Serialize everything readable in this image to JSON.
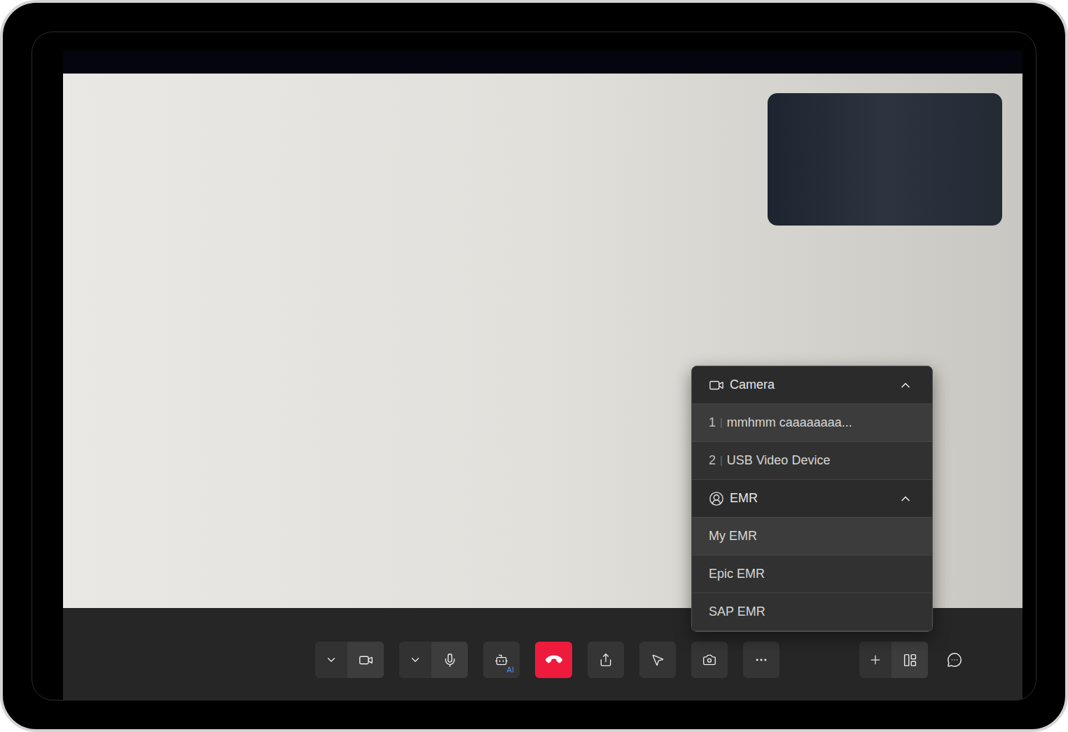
{
  "device_menu": {
    "index_separator": "|",
    "sections": [
      {
        "name": "Camera",
        "kind": "camera",
        "expanded": true,
        "items": [
          {
            "index": "1",
            "label": "mmhmm caaaaaaaa...",
            "selected": true
          },
          {
            "index": "2",
            "label": "USB Video Device",
            "selected": false
          }
        ]
      },
      {
        "name": "EMR",
        "kind": "emr",
        "expanded": true,
        "items": [
          {
            "label": "My EMR",
            "selected": true
          },
          {
            "label": "Epic EMR",
            "selected": false
          },
          {
            "label": "SAP EMR",
            "selected": false
          }
        ]
      }
    ]
  },
  "toolbar": {
    "main": [
      {
        "name": "camera",
        "kind": "split"
      },
      {
        "name": "microphone",
        "kind": "split"
      },
      {
        "name": "ai-assistant",
        "kind": "icon",
        "badge": "AI"
      },
      {
        "name": "hang-up",
        "kind": "danger"
      },
      {
        "name": "share",
        "kind": "icon"
      },
      {
        "name": "pointer",
        "kind": "icon"
      },
      {
        "name": "snapshot",
        "kind": "icon"
      },
      {
        "name": "more",
        "kind": "icon"
      }
    ],
    "side": [
      {
        "name": "add-layout",
        "kind": "split"
      },
      {
        "name": "chat",
        "kind": "plain"
      }
    ]
  }
}
